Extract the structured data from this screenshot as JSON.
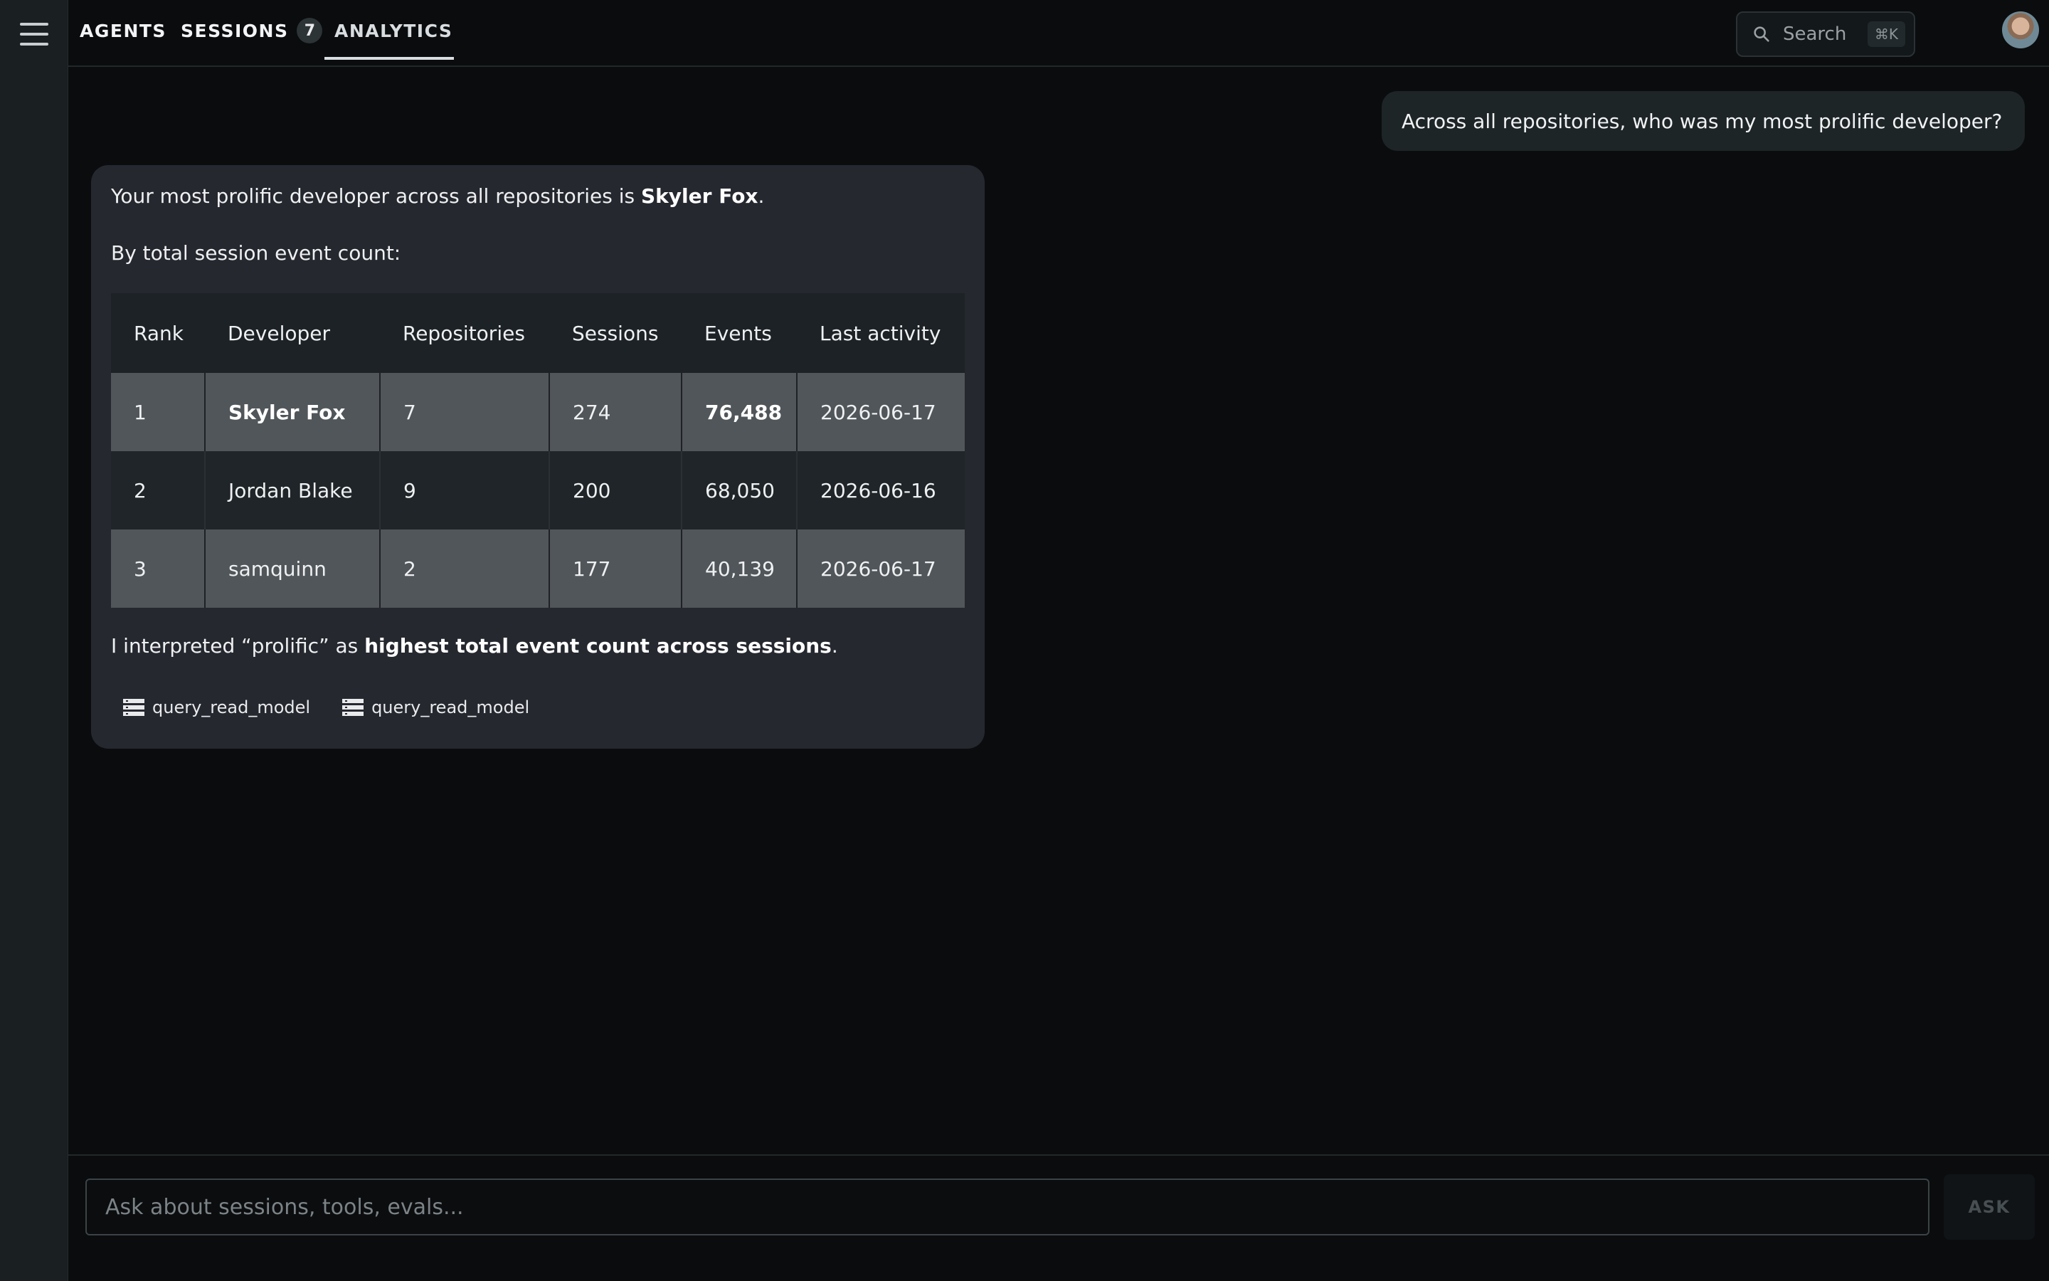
{
  "nav": {
    "tabs": [
      {
        "label": "AGENTS"
      },
      {
        "label": "SESSIONS",
        "badge": "7"
      },
      {
        "label": "ANALYTICS",
        "active": true
      }
    ]
  },
  "search": {
    "label": "Search",
    "shortcut": "⌘K"
  },
  "conversation": {
    "user_message": "Across all repositories, who was my most prolific developer?",
    "answer": {
      "intro_prefix": "Your most prolific developer across all repositories is ",
      "intro_name": "Skyler Fox",
      "intro_suffix": ".",
      "subheading": "By total session event count:",
      "table": {
        "headers": [
          "Rank",
          "Developer",
          "Repositories",
          "Sessions",
          "Events",
          "Last activity"
        ],
        "rows": [
          [
            "1",
            "Skyler Fox",
            "7",
            "274",
            "76,488",
            "2026-06-17"
          ],
          [
            "2",
            "Jordan Blake",
            "9",
            "200",
            "68,050",
            "2026-06-16"
          ],
          [
            "3",
            "samquinn",
            "2",
            "177",
            "40,139",
            "2026-06-17"
          ]
        ]
      },
      "note_prefix": "I interpreted “prolific” as ",
      "note_bold": "highest total event count across sessions",
      "note_suffix": ".",
      "tools": [
        {
          "label": "query_read_model",
          "icon": "table-icon"
        },
        {
          "label": "query_read_model",
          "icon": "table-icon"
        }
      ]
    }
  },
  "composer": {
    "placeholder": "Ask about sessions, tools, evals...",
    "button_label": "ASK"
  }
}
